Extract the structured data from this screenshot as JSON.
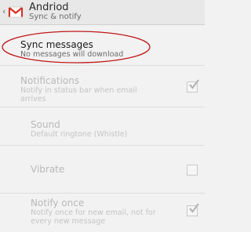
{
  "header": {
    "title": "Andriod",
    "subtitle": "Sync & notify",
    "back_glyph": "‹",
    "app_icon": "gmail-icon"
  },
  "settings": {
    "sync": {
      "title": "Sync messages",
      "summary": "No messages will download"
    },
    "notifications": {
      "title": "Notifications",
      "summary_line1": "Notify in status bar when email",
      "summary_line2": "arrives",
      "checked": true
    },
    "sound": {
      "title": "Sound",
      "summary": "Default ringtone (Whistle)"
    },
    "vibrate": {
      "title": "Vibrate",
      "checked": false
    },
    "notify_once": {
      "title": "Notify once",
      "summary_line1": "Notify once for new email, not for",
      "summary_line2": "every new message",
      "checked": true
    }
  },
  "colors": {
    "annotation": "#c01818",
    "gmail_red": "#d93025"
  }
}
